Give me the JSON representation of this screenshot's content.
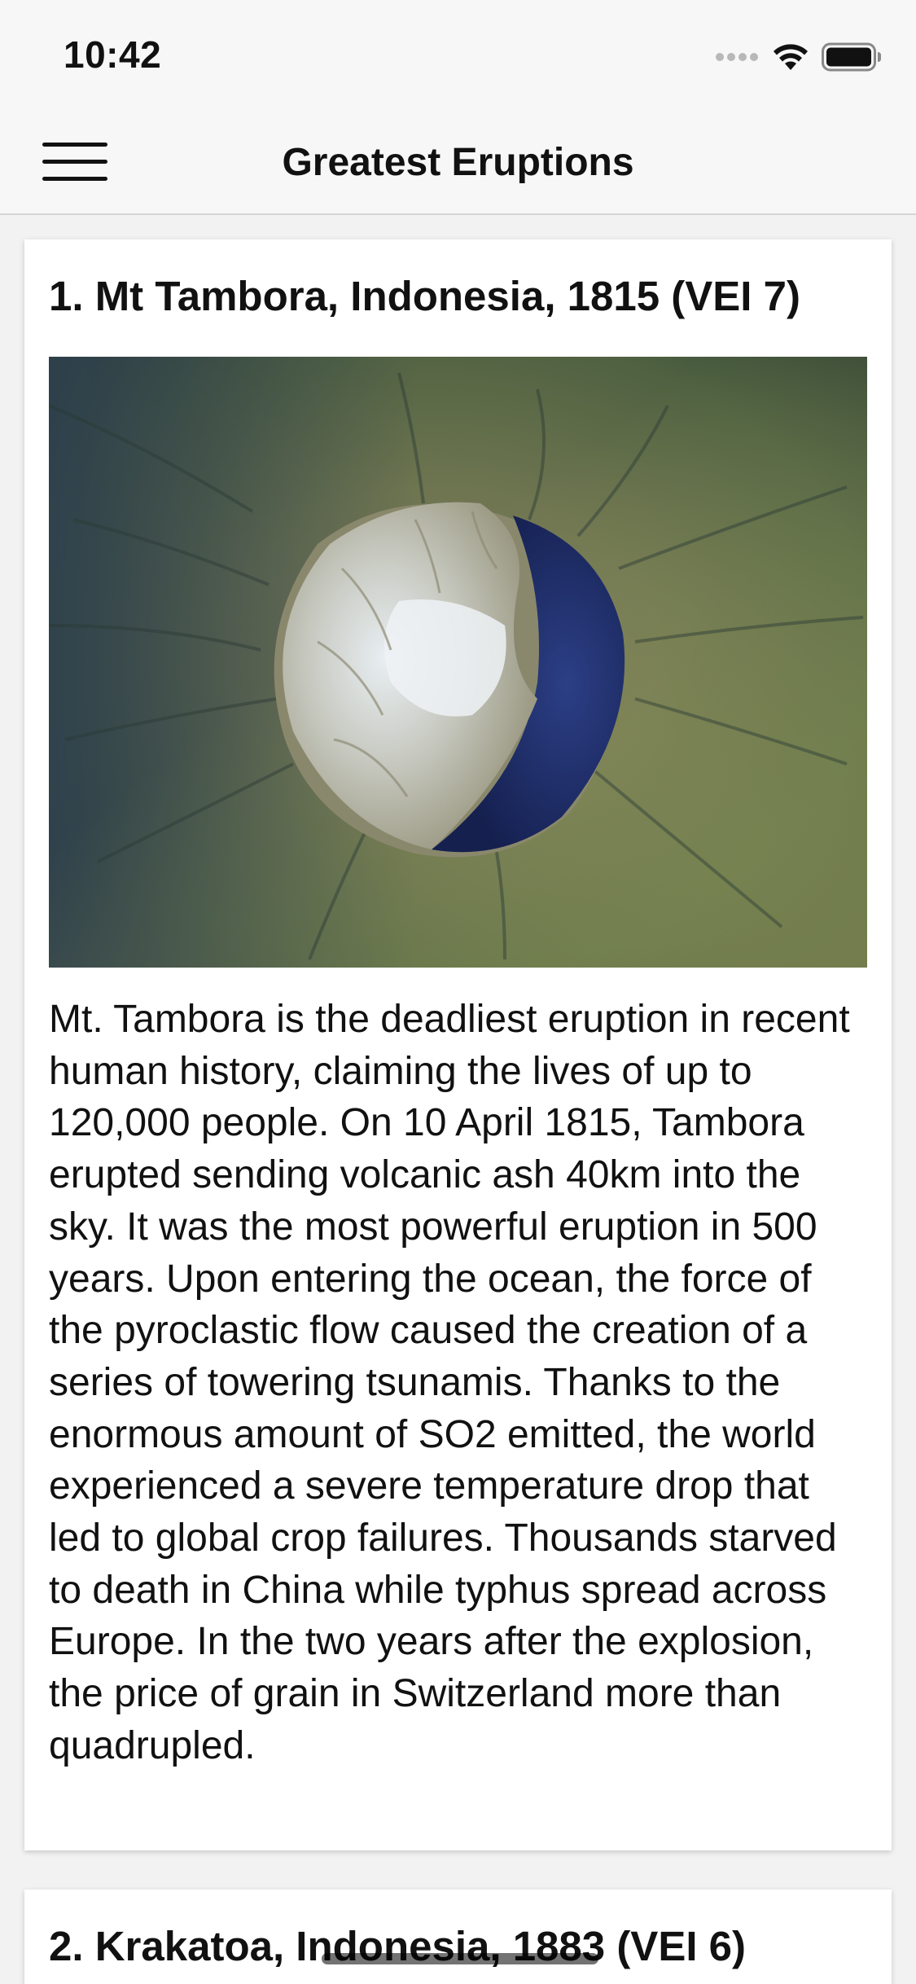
{
  "status_bar": {
    "time": "10:42",
    "icons": [
      "signal-dots-icon",
      "wifi-icon",
      "battery-icon"
    ]
  },
  "nav": {
    "menu_icon": "hamburger-menu-icon",
    "title": "Greatest Eruptions"
  },
  "eruptions": [
    {
      "title": "1. Mt Tambora, Indonesia, 1815 (VEI 7)",
      "image": "tambora-caldera-photo",
      "description": "Mt. Tambora is the deadliest eruption in recent human history, claiming the lives of up to 120,000 people. On 10 April 1815, Tambora erupted sending volcanic ash 40km into the sky. It was the most powerful eruption in 500 years. Upon entering the ocean, the force of the pyroclastic flow caused the creation of a series of towering tsunamis. Thanks to the enormous amount of SO2 emitted, the world experienced a severe temperature drop that led to global crop failures. Thousands starved to death in China while typhus spread across Europe. In the two years after the explosion, the price of grain in Switzerland more than quadrupled."
    },
    {
      "title": "2. Krakatoa, Indonesia, 1883 (VEI 6)"
    }
  ],
  "colors": {
    "background": "#f2f2f2",
    "bar": "#f7f7f7",
    "card": "#ffffff",
    "text": "#111111"
  }
}
